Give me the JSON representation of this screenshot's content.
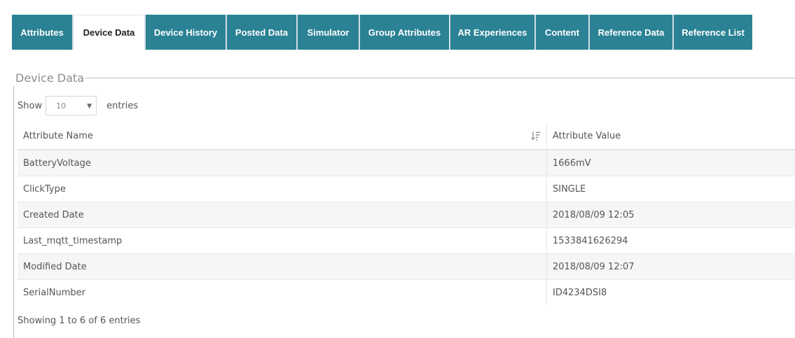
{
  "tabs": [
    {
      "label": "Attributes",
      "active": false
    },
    {
      "label": "Device Data",
      "active": true
    },
    {
      "label": "Device History",
      "active": false
    },
    {
      "label": "Posted Data",
      "active": false
    },
    {
      "label": "Simulator",
      "active": false
    },
    {
      "label": "Group Attributes",
      "active": false
    },
    {
      "label": "AR Experiences",
      "active": false
    },
    {
      "label": "Content",
      "active": false
    },
    {
      "label": "Reference Data",
      "active": false
    },
    {
      "label": "Reference List",
      "active": false
    }
  ],
  "panel": {
    "legend": "Device Data",
    "show_label": "Show",
    "entries_value": "10",
    "entries_label": "entries"
  },
  "table": {
    "columns": [
      "Attribute Name",
      "Attribute Value"
    ],
    "rows": [
      {
        "name": "BatteryVoltage",
        "value": "1666mV"
      },
      {
        "name": "ClickType",
        "value": "SINGLE"
      },
      {
        "name": "Created Date",
        "value": "2018/08/09 12:05"
      },
      {
        "name": "Last_mqtt_timestamp",
        "value": "1533841626294"
      },
      {
        "name": "Modified Date",
        "value": "2018/08/09 12:07"
      },
      {
        "name": "SerialNumber",
        "value": "ID4234DSI8"
      }
    ]
  },
  "footer": {
    "info": "Showing 1 to 6 of 6 entries"
  },
  "colors": {
    "tab_bg": "#2a8294",
    "tab_text": "#ffffff",
    "active_tab_bg": "#ffffff"
  },
  "icons": {
    "sort": "sort-amount-icon",
    "dropdown": "chevron-down-icon"
  }
}
